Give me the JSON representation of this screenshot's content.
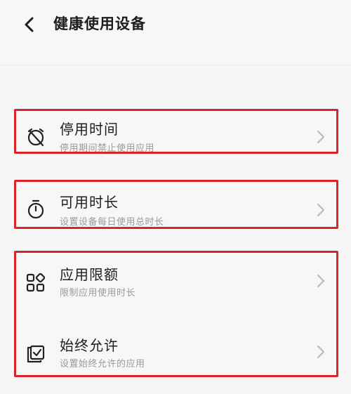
{
  "header": {
    "title": "健康使用设备",
    "back_icon": "chevron-left-icon"
  },
  "items": [
    {
      "label": "停用时间",
      "sub": "停用期间禁止使用应用",
      "icon": "alarm-off-icon"
    },
    {
      "label": "可用时长",
      "sub": "设置设备每日使用总时长",
      "icon": "stopwatch-icon"
    },
    {
      "label": "应用限额",
      "sub": "限制应用使用时长",
      "icon": "apps-grid-icon"
    },
    {
      "label": "始终允许",
      "sub": "设置始终允许的应用",
      "icon": "checked-app-icon"
    }
  ],
  "colors": {
    "highlight": "#d9242a",
    "text": "#1e1e1e",
    "subtext": "#9a9a9a"
  }
}
